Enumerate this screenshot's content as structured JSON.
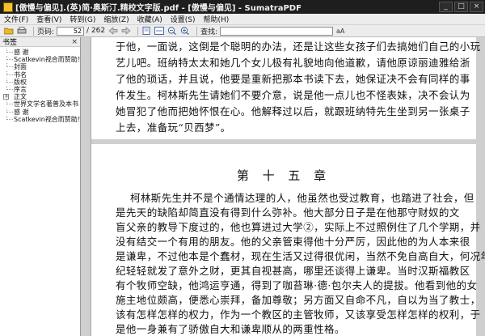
{
  "window": {
    "title": "[傲慢与偏见].(英)简·奥斯汀.精校文字版.pdf - [傲慢与偏见] - SumatraPDF",
    "min_label": "_",
    "max_label": "□",
    "close_label": "×"
  },
  "menu": {
    "items": [
      "文件(F)",
      "查看(V)",
      "转到(G)",
      "缩放(Z)",
      "收藏(A)",
      "设置(S)",
      "帮助(H)"
    ]
  },
  "toolbar": {
    "page_label": "页码:",
    "page_value": "52",
    "page_total": "/ 262",
    "find_label": "查找:",
    "search_value": ""
  },
  "sidebar": {
    "title": "书签",
    "close_label": "×",
    "items": [
      {
        "label": "感  谢",
        "expander": ""
      },
      {
        "label": "Scatkevin视合而赞助！",
        "expander": ""
      },
      {
        "label": "封面",
        "expander": ""
      },
      {
        "label": "书名",
        "expander": ""
      },
      {
        "label": "版权",
        "expander": ""
      },
      {
        "label": "序言",
        "expander": ""
      },
      {
        "label": "正文",
        "expander": "+"
      },
      {
        "label": "世界文学名著普及本书",
        "expander": ""
      },
      {
        "label": "感  谢",
        "expander": ""
      },
      {
        "label": "Scatkevin视合而赞助！",
        "expander": ""
      }
    ]
  },
  "document": {
    "top_paragraph_lines": [
      "于他，一面说，这倒是个聪明的办法，还是让这些女孩子们去搞她们自己的小玩",
      "艺儿吧。班纳特太太和她几个女儿极有礼貌地向他道歉，请他原谅丽迪雅给浙",
      "了他的琐话，并且说，他要是重新把那本书读下去，她保证决不会有同样的事",
      "件发生。柯林斯先生请她们不要介意，说是他一点儿也不怪表妹，决不会认为",
      "她冒犯了他而把她怀恨在心。他解释过以后，就跟班纳特先生坐到另一张桌子",
      "上去，准备玩“贝西梦”。"
    ],
    "chapter_title": "第 十 五 章",
    "chapter_lines": [
      "柯林斯先生并不是个通情达理的人，他虽然也受过教育，也踏进了社会，但",
      "是先天的缺陷却简直没有得到什么弥补。他大部分日子是在他那守财奴的文",
      "盲父亲的教导下度过的，他也算进过大学②，实际上不过照例住了几个学期，并",
      "没有结交一个有用的朋友。他的父亲管束得他十分严厉，因此他的为人本来很",
      "是谦卑，不过他本是个蠢材，现在生活又过得很优闲，当然不免自高自大，何况年",
      "纪轻轻就发了意外之财，更其自视甚高，哪里还谈得上谦卑。当时汉斯福教区",
      "有个牧师空缺，他鸿运亨通，得到了咖苔琳·德·包尔夫人的提拔。他看到他的女",
      "施主地位颇高，便悉心崇拜，备加尊敬；另方面又自命不凡，自以为当了教士，",
      "该有怎样怎样的权力，作为一个教区的主管牧师，又该享受怎样怎样的权利，于",
      "是他一身兼有了骄傲自大和谦卑顺从的两重性格。"
    ]
  }
}
